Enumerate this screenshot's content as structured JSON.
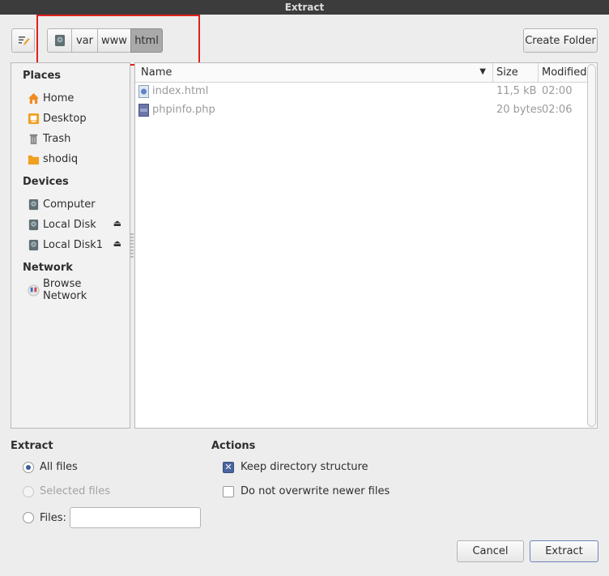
{
  "window": {
    "title": "Extract"
  },
  "toolbar": {
    "path": [
      "var",
      "www",
      "html"
    ],
    "create_folder": "Create Folder"
  },
  "sidebar": {
    "places_heading": "Places",
    "places": [
      "Home",
      "Desktop",
      "Trash",
      "shodiq"
    ],
    "devices_heading": "Devices",
    "devices": [
      "Computer",
      "Local Disk",
      "Local Disk1"
    ],
    "network_heading": "Network",
    "network": [
      "Browse Network"
    ]
  },
  "files": {
    "columns": {
      "name": "Name",
      "size": "Size",
      "modified": "Modified"
    },
    "rows": [
      {
        "name": "index.html",
        "size": "11,5 kB",
        "modified": "02:00",
        "icon": "html-file-icon"
      },
      {
        "name": "phpinfo.php",
        "size": "20 bytes",
        "modified": "02:06",
        "icon": "php-file-icon"
      }
    ]
  },
  "extract": {
    "heading": "Extract",
    "all_files": "All files",
    "selected_files": "Selected files",
    "files": "Files:",
    "files_value": ""
  },
  "actions": {
    "heading": "Actions",
    "keep_structure": "Keep directory structure",
    "no_overwrite": "Do not overwrite newer files"
  },
  "buttons": {
    "cancel": "Cancel",
    "extract": "Extract"
  },
  "colors": {
    "accent": "#3c5a96",
    "highlight": "#e0201c"
  }
}
